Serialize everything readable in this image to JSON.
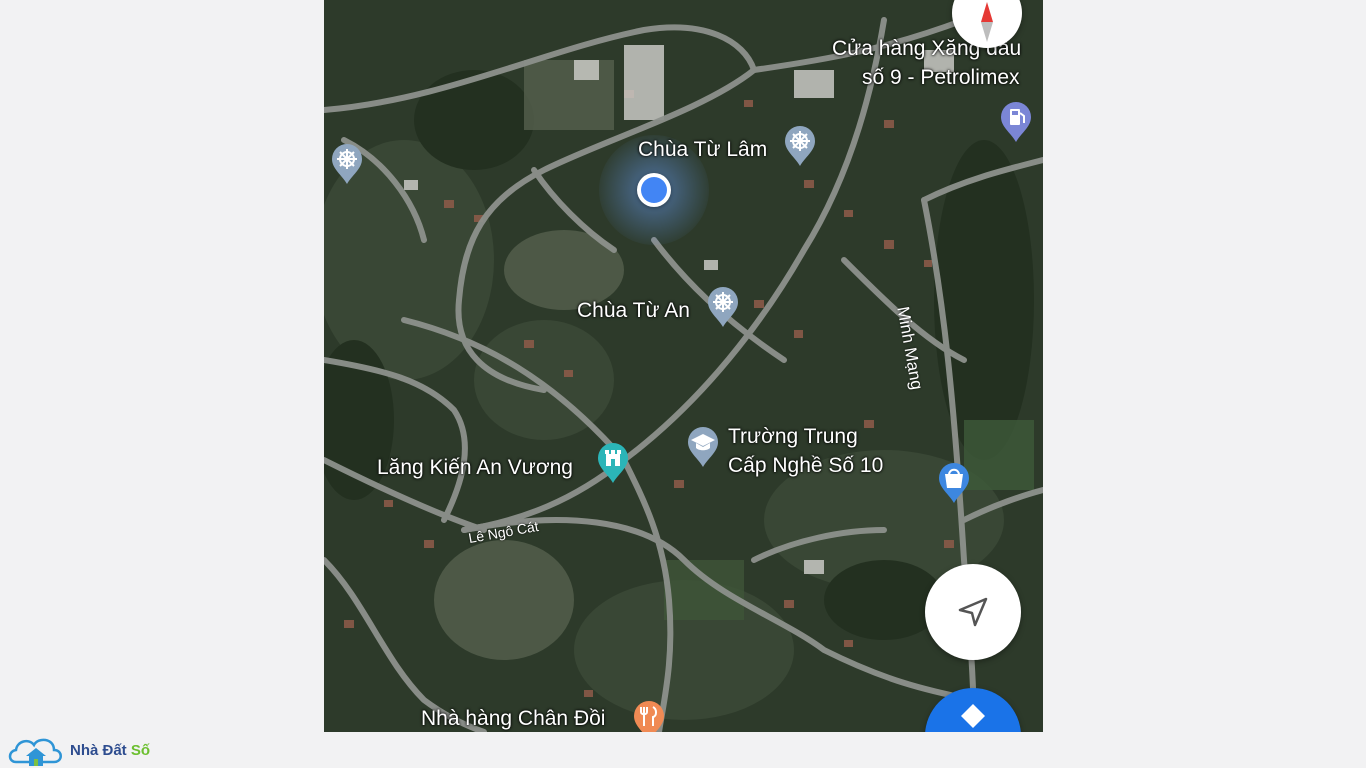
{
  "map": {
    "labels": {
      "petrolimex_line1": "Cửa hàng Xăng dầu",
      "petrolimex_line2": "số 9 - Petrolimex",
      "chua_tu_lam": "Chùa Từ Lâm",
      "chua_tu_an": "Chùa Từ An",
      "truong_line1": "Trường Trung",
      "truong_line2": "Cấp Nghề Số 10",
      "lang_kien_an_vuong": "Lăng Kiến An Vương",
      "road_le_ngo_cat": "Lê Ngô Cát",
      "road_minh_mang": "Minh Mạng",
      "nha_hang": "Nhà hàng Chân Đồi"
    },
    "icons": {
      "temple": "dharma-wheel-icon",
      "fuel": "fuel-pump-icon",
      "school": "graduation-cap-icon",
      "monument": "monument-icon",
      "shop": "shopping-bag-icon",
      "restaurant": "fork-knife-icon",
      "compass": "compass-icon",
      "navigate": "navigation-arrow-icon",
      "directions": "directions-icon"
    },
    "colors": {
      "location_dot": "#4285f4",
      "pin_temple": "#8fa6bf",
      "pin_fuel": "#7b86d6",
      "pin_monument": "#2bb5b8",
      "pin_shop": "#3d87e0",
      "pin_restaurant": "#f08a54",
      "directions_fab": "#1a73e8"
    }
  },
  "logo": {
    "brand_part1": "Nhà Đất ",
    "brand_part2": "Số"
  }
}
